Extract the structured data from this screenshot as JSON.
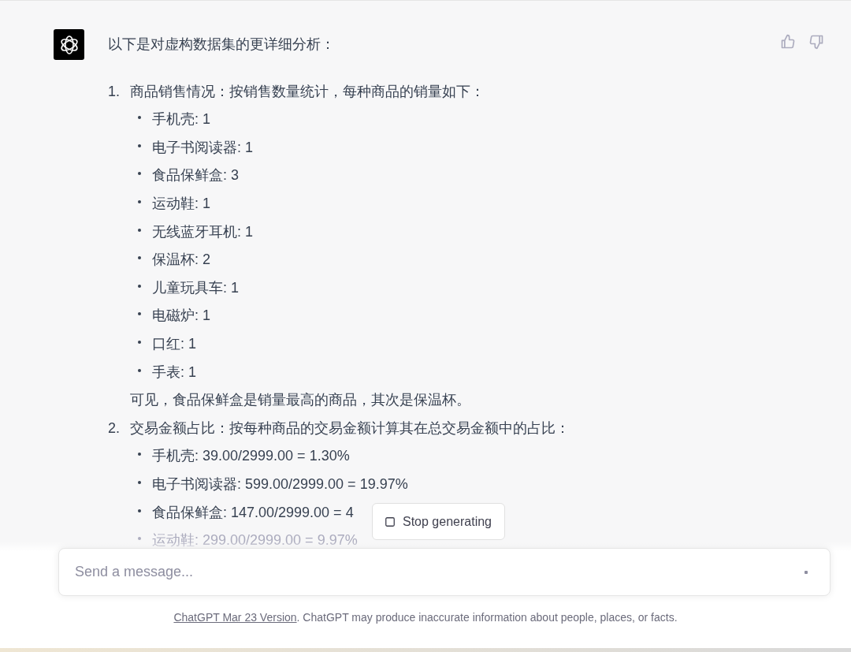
{
  "message": {
    "intro": "以下是对虚构数据集的更详细分析：",
    "sections": [
      {
        "number": "1.",
        "heading": "商品销售情况：按销售数量统计，每种商品的销量如下：",
        "items": [
          {
            "text": "手机壳: 1",
            "faded": false
          },
          {
            "text": "电子书阅读器: 1",
            "faded": false
          },
          {
            "text": "食品保鲜盒: 3",
            "faded": false
          },
          {
            "text": "运动鞋: 1",
            "faded": false
          },
          {
            "text": "无线蓝牙耳机: 1",
            "faded": false
          },
          {
            "text": "保温杯: 2",
            "faded": false
          },
          {
            "text": "儿童玩具车: 1",
            "faded": false
          },
          {
            "text": "电磁炉: 1",
            "faded": false
          },
          {
            "text": "口红: 1",
            "faded": false
          },
          {
            "text": "手表: 1",
            "faded": false
          }
        ],
        "note": "可见，食品保鲜盒是销量最高的商品，其次是保温杯。"
      },
      {
        "number": "2.",
        "heading": "交易金额占比：按每种商品的交易金额计算其在总交易金额中的占比：",
        "items": [
          {
            "text": "手机壳: 39.00/2999.00 = 1.30%",
            "faded": false
          },
          {
            "text": "电子书阅读器: 599.00/2999.00 = 19.97%",
            "faded": false
          },
          {
            "text": "食品保鲜盒: 147.00/2999.00 = 4",
            "faded": false
          },
          {
            "text": "运动鞋: 299.00/2999.00 = 9.97%",
            "faded": true
          }
        ]
      }
    ]
  },
  "stop_button": {
    "label": "Stop generating"
  },
  "composer": {
    "placeholder": "Send a message..."
  },
  "footer": {
    "link": "ChatGPT Mar 23 Version",
    "text": ". ChatGPT may produce inaccurate information about people, places, or facts."
  }
}
